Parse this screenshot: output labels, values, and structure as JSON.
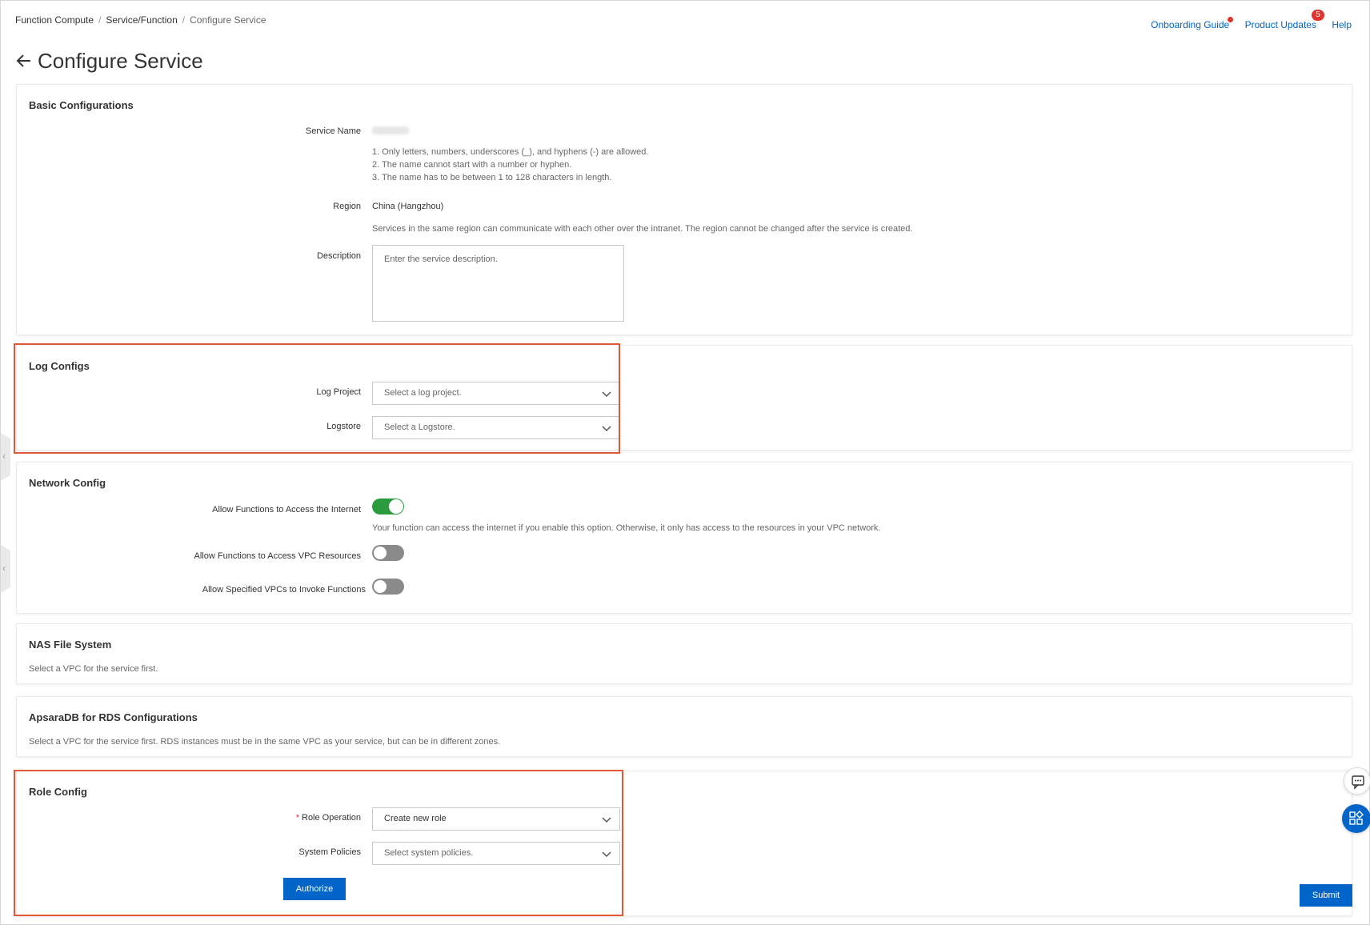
{
  "breadcrumb": [
    "Function Compute",
    "Service/Function",
    "Configure Service"
  ],
  "top_links": {
    "onboarding": "Onboarding Guide",
    "updates": "Product Updates",
    "updates_badge": "5",
    "help": "Help"
  },
  "page": {
    "title": "Configure Service"
  },
  "basic": {
    "title": "Basic Configurations",
    "service_name_label": "Service Name",
    "service_name_hints": [
      "1. Only letters, numbers, underscores (_), and hyphens (-) are allowed.",
      "2. The name cannot start with a number or hyphen.",
      "3. The name has to be between 1 to 128 characters in length."
    ],
    "region_label": "Region",
    "region_value": "China (Hangzhou)",
    "region_hint": "Services in the same region can communicate with each other over the intranet. The region cannot be changed after the service is created.",
    "description_label": "Description",
    "description_placeholder": "Enter the service description."
  },
  "log": {
    "title": "Log Configs",
    "project_label": "Log Project",
    "project_placeholder": "Select a log project.",
    "logstore_label": "Logstore",
    "logstore_placeholder": "Select a Logstore."
  },
  "network": {
    "title": "Network Config",
    "internet_label": "Allow Functions to Access the Internet",
    "internet_on": true,
    "internet_hint": "Your function can access the internet if you enable this option. Otherwise, it only has access to the resources in your VPC network.",
    "vpc_label": "Allow Functions to Access VPC Resources",
    "vpc_on": false,
    "invoke_label": "Allow Specified VPCs to Invoke Functions",
    "invoke_on": false
  },
  "nas": {
    "title": "NAS File System",
    "hint": "Select a VPC for the service first."
  },
  "rds": {
    "title": "ApsaraDB for RDS Configurations",
    "hint": "Select a VPC for the service first. RDS instances must be in the same VPC as your service, but can be in different zones."
  },
  "role": {
    "title": "Role Config",
    "required_mark": "*",
    "operation_label": "Role Operation",
    "operation_value": "Create new role",
    "policies_label": "System Policies",
    "policies_placeholder": "Select system policies.",
    "authorize_label": "Authorize"
  },
  "submit_label": "Submit",
  "colors": {
    "primary": "#0064c8",
    "toggle_on": "#2a9c3e",
    "highlight": "#e2573a",
    "badge": "#e0342f"
  },
  "icons": [
    "back-arrow-icon",
    "chevron-down-icon",
    "chat-icon",
    "apps-icon",
    "collapse-arrow-icon"
  ]
}
